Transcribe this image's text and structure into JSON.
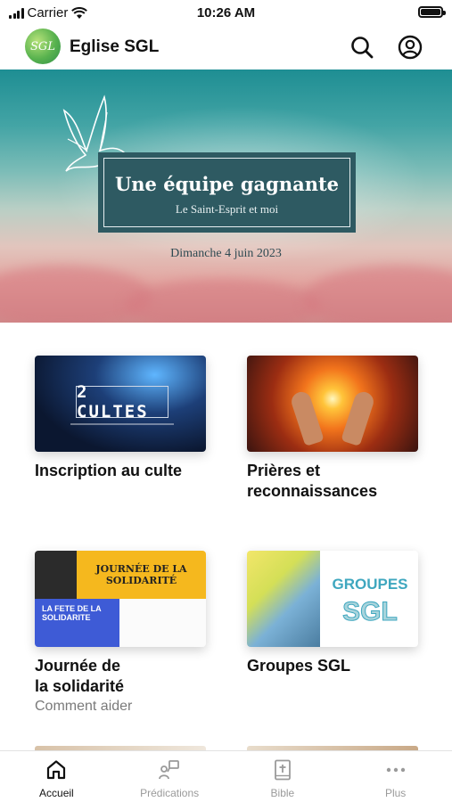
{
  "status_bar": {
    "carrier": "Carrier",
    "time": "10:26 AM",
    "battery_level": 1.0
  },
  "header": {
    "logo_text": "SGL",
    "title": "Eglise SGL",
    "icons": [
      "search-icon",
      "account-icon"
    ]
  },
  "hero": {
    "title": "Une équipe gagnante",
    "subtitle": "Le Saint-Esprit et moi",
    "date": "Dimanche 4 juin 2023"
  },
  "cards": [
    {
      "title_line1": "Inscription au culte",
      "title_line2": "",
      "subtitle": "",
      "thumb_text": "2 CULTES"
    },
    {
      "title_line1": "Prières et",
      "title_line2": "reconnaissances",
      "subtitle": ""
    },
    {
      "title_line1": "Journée de",
      "title_line2": "la solidarité",
      "subtitle": "Comment aider",
      "thumb_text_top": "JOURNÉE DE LA SOLIDARITÉ",
      "thumb_text_left": "LA FETE DE LA SOLIDARITE"
    },
    {
      "title_line1": "Groupes SGL",
      "title_line2": "",
      "subtitle": "",
      "thumb_text_top": "GROUPES",
      "thumb_text_bottom": "SGL"
    }
  ],
  "tabs": [
    {
      "label": "Accueil",
      "icon": "home-icon",
      "active": true
    },
    {
      "label": "Prédications",
      "icon": "preaching-icon",
      "active": false
    },
    {
      "label": "Bible",
      "icon": "bible-icon",
      "active": false
    },
    {
      "label": "Plus",
      "icon": "more-icon",
      "active": false
    }
  ],
  "colors": {
    "accent_active": "#111111",
    "tab_inactive": "#9a9a9a",
    "hero_panel": "#2e5a62"
  }
}
